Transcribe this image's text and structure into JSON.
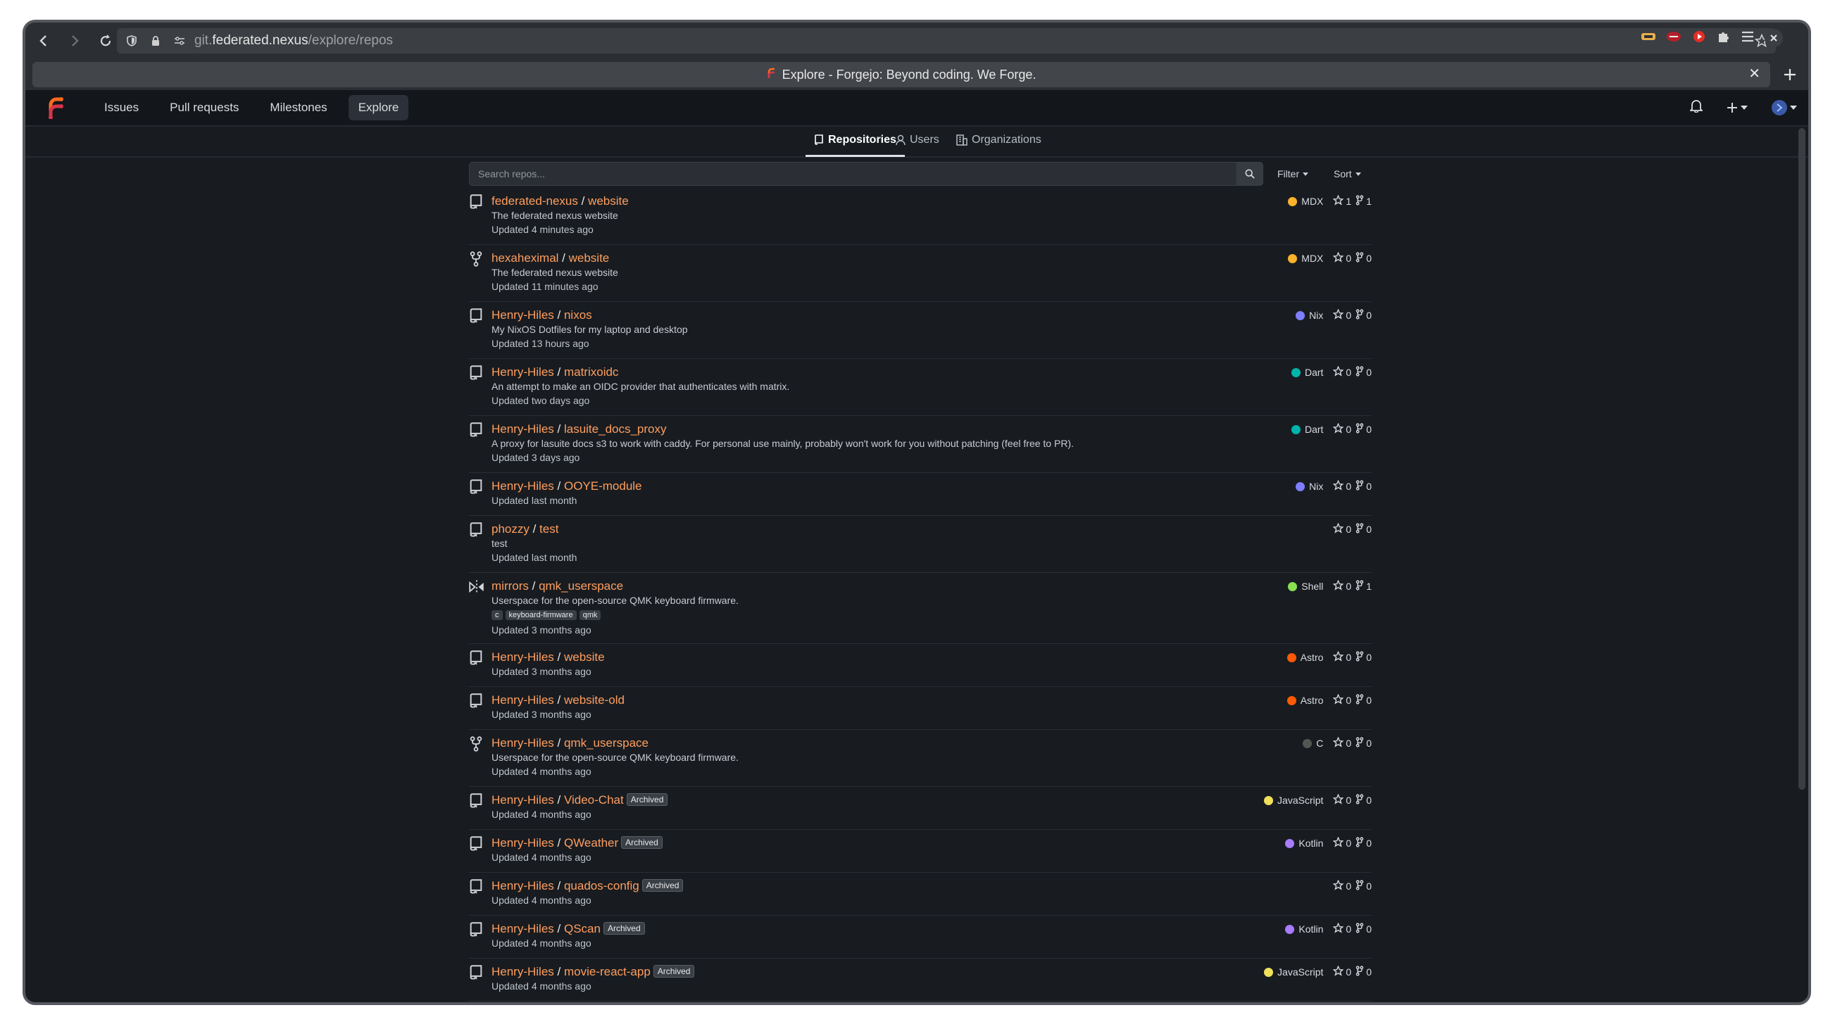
{
  "browser": {
    "url_prefix": "git.",
    "url_host": "federated.nexus",
    "url_path": "/explore/repos",
    "tab_title": "Explore - Forgejo: Beyond coding. We Forge.",
    "close_glyph": "✕"
  },
  "nav": {
    "items": [
      "Issues",
      "Pull requests",
      "Milestones",
      "Explore"
    ],
    "active": "Explore"
  },
  "subtabs": {
    "repositories": "Repositories",
    "users": "Users",
    "organizations": "Organizations"
  },
  "search": {
    "placeholder": "Search repos...",
    "filter_label": "Filter",
    "sort_label": "Sort"
  },
  "colors": {
    "accent": "#ff9e5e",
    "MDX": "#fcb32c",
    "Nix": "#7e7eff",
    "Dart": "#00b4ab",
    "Shell": "#89e051",
    "Astro": "#ff5a03",
    "C": "#555555",
    "JavaScript": "#f1e05a",
    "Kotlin": "#a97bff"
  },
  "repos": [
    {
      "icon": "repo",
      "owner": "federated-nexus",
      "name": "website",
      "archived": "",
      "desc": "The federated nexus website",
      "topics": [],
      "updated": "Updated 4 minutes ago",
      "lang": "MDX",
      "color": "#fcb32c",
      "stars": "1",
      "forks": "1"
    },
    {
      "icon": "fork",
      "owner": "hexaheximal",
      "name": "website",
      "archived": "",
      "desc": "The federated nexus website",
      "topics": [],
      "updated": "Updated 11 minutes ago",
      "lang": "MDX",
      "color": "#fcb32c",
      "stars": "0",
      "forks": "0"
    },
    {
      "icon": "repo",
      "owner": "Henry-Hiles",
      "name": "nixos",
      "archived": "",
      "desc": "My NixOS Dotfiles for my laptop and desktop",
      "topics": [],
      "updated": "Updated 13 hours ago",
      "lang": "Nix",
      "color": "#7e7eff",
      "stars": "0",
      "forks": "0"
    },
    {
      "icon": "repo",
      "owner": "Henry-Hiles",
      "name": "matrixoidc",
      "archived": "",
      "desc": "An attempt to make an OIDC provider that authenticates with matrix.",
      "topics": [],
      "updated": "Updated two days ago",
      "lang": "Dart",
      "color": "#00b4ab",
      "stars": "0",
      "forks": "0"
    },
    {
      "icon": "repo",
      "owner": "Henry-Hiles",
      "name": "lasuite_docs_proxy",
      "archived": "",
      "desc": "A proxy for lasuite docs s3 to work with caddy. For personal use mainly, probably won't work for you without patching (feel free to PR).",
      "topics": [],
      "updated": "Updated 3 days ago",
      "lang": "Dart",
      "color": "#00b4ab",
      "stars": "0",
      "forks": "0"
    },
    {
      "icon": "repo",
      "owner": "Henry-Hiles",
      "name": "OOYE-module",
      "archived": "",
      "desc": "",
      "topics": [],
      "updated": "Updated last month",
      "lang": "Nix",
      "color": "#7e7eff",
      "stars": "0",
      "forks": "0"
    },
    {
      "icon": "repo",
      "owner": "phozzy",
      "name": "test",
      "archived": "",
      "desc": "test",
      "topics": [],
      "updated": "Updated last month",
      "lang": "",
      "color": "",
      "stars": "0",
      "forks": "0"
    },
    {
      "icon": "mirror",
      "owner": "mirrors",
      "name": "qmk_userspace",
      "archived": "",
      "desc": "Userspace for the open-source QMK keyboard firmware.",
      "topics": [
        "c",
        "keyboard-firmware",
        "qmk"
      ],
      "updated": "Updated 3 months ago",
      "lang": "Shell",
      "color": "#89e051",
      "stars": "0",
      "forks": "1"
    },
    {
      "icon": "repo",
      "owner": "Henry-Hiles",
      "name": "website",
      "archived": "",
      "desc": "",
      "topics": [],
      "updated": "Updated 3 months ago",
      "lang": "Astro",
      "color": "#ff5a03",
      "stars": "0",
      "forks": "0"
    },
    {
      "icon": "repo",
      "owner": "Henry-Hiles",
      "name": "website-old",
      "archived": "",
      "desc": "",
      "topics": [],
      "updated": "Updated 3 months ago",
      "lang": "Astro",
      "color": "#ff5a03",
      "stars": "0",
      "forks": "0"
    },
    {
      "icon": "fork",
      "owner": "Henry-Hiles",
      "name": "qmk_userspace",
      "archived": "",
      "desc": "Userspace for the open-source QMK keyboard firmware.",
      "topics": [],
      "updated": "Updated 4 months ago",
      "lang": "C",
      "color": "#555555",
      "stars": "0",
      "forks": "0"
    },
    {
      "icon": "repo",
      "owner": "Henry-Hiles",
      "name": "Video-Chat",
      "archived": "Archived",
      "desc": "",
      "topics": [],
      "updated": "Updated 4 months ago",
      "lang": "JavaScript",
      "color": "#f1e05a",
      "stars": "0",
      "forks": "0"
    },
    {
      "icon": "repo",
      "owner": "Henry-Hiles",
      "name": "QWeather",
      "archived": "Archived",
      "desc": "",
      "topics": [],
      "updated": "Updated 4 months ago",
      "lang": "Kotlin",
      "color": "#a97bff",
      "stars": "0",
      "forks": "0"
    },
    {
      "icon": "repo",
      "owner": "Henry-Hiles",
      "name": "quados-config",
      "archived": "Archived",
      "desc": "",
      "topics": [],
      "updated": "Updated 4 months ago",
      "lang": "",
      "color": "",
      "stars": "0",
      "forks": "0"
    },
    {
      "icon": "repo",
      "owner": "Henry-Hiles",
      "name": "QScan",
      "archived": "Archived",
      "desc": "",
      "topics": [],
      "updated": "Updated 4 months ago",
      "lang": "Kotlin",
      "color": "#a97bff",
      "stars": "0",
      "forks": "0"
    },
    {
      "icon": "repo",
      "owner": "Henry-Hiles",
      "name": "movie-react-app",
      "archived": "Archived",
      "desc": "",
      "topics": [],
      "updated": "Updated 4 months ago",
      "lang": "JavaScript",
      "color": "#f1e05a",
      "stars": "0",
      "forks": "0"
    }
  ]
}
